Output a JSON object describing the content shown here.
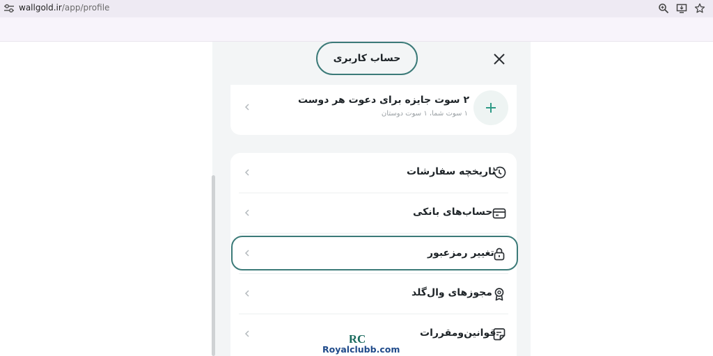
{
  "browser": {
    "url_host": "wallgold.ir",
    "url_path": "/app/profile"
  },
  "header": {
    "title": "حساب کاربری"
  },
  "invite": {
    "title": "۲ سوت جایزه برای دعوت هر دوست",
    "subtitle": "۱ سوت شما، ۱ سوت دوستان"
  },
  "menu": {
    "items": [
      {
        "label": "تاریخچه سفارشات",
        "icon": "history-icon"
      },
      {
        "label": "حساب‌های بانکی",
        "icon": "credit-card-icon"
      },
      {
        "label": "تغییر رمزعبور",
        "icon": "lock-icon"
      },
      {
        "label": "مجوزهای وال‌گلد",
        "icon": "badge-icon"
      },
      {
        "label": "قوانین‌ومقررات",
        "icon": "note-icon"
      }
    ]
  },
  "watermark": {
    "logo_text": "RC",
    "text": "Royalclubb.com"
  },
  "colors": {
    "accent": "#3b7a78",
    "plus": "#2e9a86"
  }
}
